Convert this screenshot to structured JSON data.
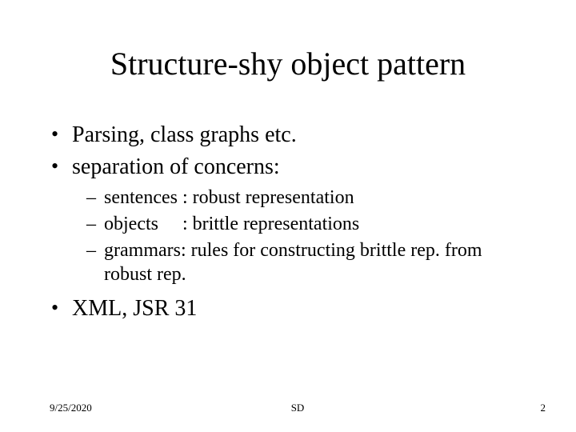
{
  "title": "Structure-shy object pattern",
  "bullets": {
    "b1": "Parsing, class graphs etc.",
    "b2": "separation of concerns:",
    "sub1": "sentences : robust representation",
    "sub2": "objects  : brittle representations",
    "sub3": "grammars: rules for constructing brittle rep. from robust rep.",
    "b3": "XML, JSR 31"
  },
  "footer": {
    "date": "9/25/2020",
    "center": "SD",
    "page": "2"
  }
}
